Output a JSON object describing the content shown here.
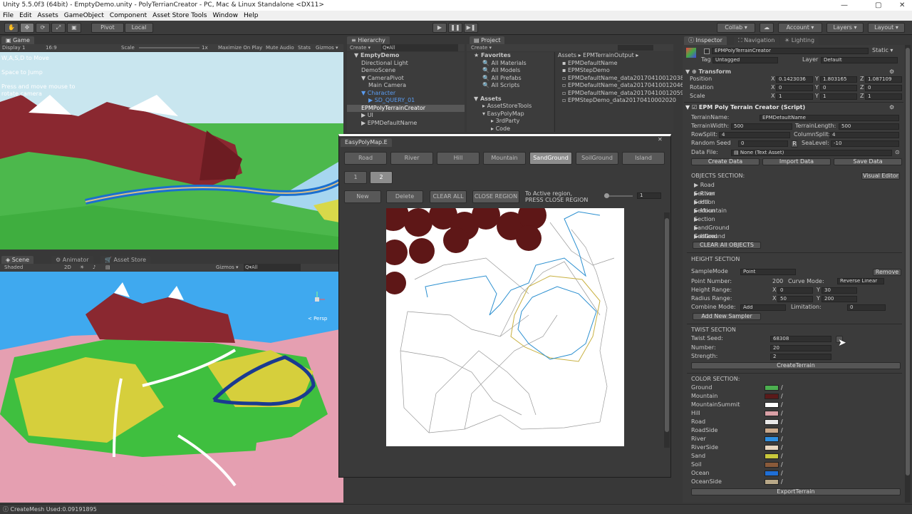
{
  "window": {
    "title": "Unity 5.5.0f3 (64bit) - EmptyDemo.unity - PolyTerrianCreator - PC, Mac & Linux Standalone <DX11>",
    "controls": [
      "—",
      "▢",
      "✕"
    ]
  },
  "menu": [
    "File",
    "Edit",
    "Assets",
    "GameObject",
    "Component",
    "Asset Store Tools",
    "Window",
    "Help"
  ],
  "toolbar": {
    "pivot": "Pivot",
    "local": "Local",
    "collab": "Collab ▾",
    "account": "Account ▾",
    "layers": "Layers ▾",
    "layout": "Layout ▾"
  },
  "game": {
    "tab": "Game",
    "display": "Display 1",
    "aspect": "16:9",
    "scale_label": "Scale",
    "scale_value": "1x",
    "maximize": "Maximize On Play",
    "mute": "Mute Audio",
    "stats": "Stats",
    "gizmos": "Gizmos ▾",
    "overlay": [
      "W,A,S,D to Move",
      "Space to Jump",
      "Press and move mouse to rotate camera"
    ]
  },
  "scene": {
    "tabs": [
      "Scene",
      "Animator",
      "Asset Store"
    ],
    "shaded": "Shaded",
    "mode2d": "2D",
    "gizmos": "Gizmos ▾",
    "search": "Q▾All",
    "persp": "< Persp"
  },
  "hierarchy": {
    "tab": "Hierarchy",
    "create": "Create ▾",
    "search": "Q▾All",
    "items": [
      {
        "label": "▼ EmptyDemo",
        "indent": 0,
        "bold": true
      },
      {
        "label": "Directional Light",
        "indent": 1
      },
      {
        "label": "DemoScene",
        "indent": 1
      },
      {
        "label": "▼ CameraPivot",
        "indent": 1
      },
      {
        "label": "Main Camera",
        "indent": 2
      },
      {
        "label": "▼ Character",
        "indent": 1,
        "blue": true
      },
      {
        "label": "▶ SD_QUERY_01",
        "indent": 2,
        "blue": true
      },
      {
        "label": "EPMPolyTerrainCreator",
        "indent": 1,
        "selected": true
      },
      {
        "label": "▶ UI",
        "indent": 1
      },
      {
        "label": "▶ EPMDefaultName",
        "indent": 1
      }
    ]
  },
  "project": {
    "tab": "Project",
    "create": "Create ▾",
    "favorites_label": "Favorites",
    "favorites": [
      "All Materials",
      "All Models",
      "All Prefabs",
      "All Scripts"
    ],
    "assets_label": "Assets",
    "assets": [
      "AssetStoreTools",
      "EasyPolyMap",
      "3rdParty",
      "Code"
    ],
    "breadcrumb": "Assets ▸ EPMTerrainOutput ▸",
    "files": [
      "EPMDefaultName",
      "EPMStepDemo",
      "EPMDefaultName_data20170410012038",
      "EPMDefaultName_data20170410012046",
      "EPMDefaultName_data20170410012059",
      "EPMStepDemo_data20170410002020"
    ]
  },
  "easypolymap": {
    "tab": "EasyPolyMap.E",
    "types": [
      "Road",
      "River",
      "Hill",
      "Mountain",
      "SandGround",
      "SoilGround",
      "Island"
    ],
    "selected_type": "SandGround",
    "pages": [
      "1",
      "2"
    ],
    "selected_page": "2",
    "actions": {
      "new": "New",
      "delete": "Delete",
      "clear_all": "CLEAR ALL",
      "close_region": "CLOSE REGION"
    },
    "hint_line1": "To Active region,",
    "hint_line2": "PRESS CLOSE REGION",
    "slider_value": "1"
  },
  "inspector": {
    "tabs": [
      "Inspector",
      "Navigation",
      "Lighting"
    ],
    "object_name": "EPMPolyTerrainCreator",
    "static_label": "Static ▾",
    "tag_label": "Tag",
    "tag_value": "Untagged",
    "layer_label": "Layer",
    "layer_value": "Default",
    "transform": {
      "title": "Transform",
      "position_label": "Position",
      "rotation_label": "Rotation",
      "scale_label": "Scale",
      "position": [
        "0.1423036",
        "1.803165",
        "1.087109"
      ],
      "rotation": [
        "0",
        "0",
        "0"
      ],
      "scale": [
        "1",
        "1",
        "1"
      ]
    },
    "script": {
      "title": "EPM Poly Terrain Creator (Script)",
      "terrain_name_label": "TerrainName:",
      "terrain_name": "EPMDefaultName",
      "width_label": "TerrainWidth:",
      "width": "500",
      "length_label": "TerrainLength:",
      "length": "500",
      "rowsplit_label": "RowSplit:",
      "rowsplit": "4",
      "colsplit_label": "ColumnSplit:",
      "colsplit": "4",
      "seed_label": "Random Seed",
      "seed": "0",
      "r_btn": "R",
      "sealevel_label": "SeaLevel:",
      "sealevel": "-10",
      "datafile_label": "Data File:",
      "datafile": "None (Text Asset)",
      "create_data": "Create Data",
      "import_data": "Import Data",
      "save_data": "Save Data"
    },
    "objects": {
      "title": "OBJECTS SECTION:",
      "visual_editor": "Visual Editor",
      "items": [
        "Road Section",
        "River Section",
        "Hill Section",
        "Mountain Section",
        "SandGround Section",
        "SoilGround Section",
        "Island Section"
      ],
      "clear": "CLEAR All OBJECTS"
    },
    "height": {
      "title": "HEIGHT SECTION",
      "samplemode_label": "SampleMode",
      "samplemode": "Point",
      "remove": "Remove",
      "pointnumber_label": "Point Number:",
      "pointnumber": "200",
      "curve_label": "Curve Mode:",
      "curve": "Reverse Linear",
      "heightrange_label": "Height Range:",
      "heightrange_x": "0",
      "heightrange_y": "30",
      "radiusrange_label": "Radius Range:",
      "radiusrange_x": "50",
      "radiusrange_y": "200",
      "combine_label": "Combine Mode:",
      "combine": "Add",
      "limitation_label": "Limitation:",
      "limitation": "0",
      "add_sampler": "Add New Sampler"
    },
    "twist": {
      "title": "TWIST SECTION",
      "seed_label": "Twist Seed:",
      "seed": "68308",
      "number_label": "Number:",
      "number": "20",
      "strength_label": "Strength:",
      "strength": "2",
      "create": "CreateTerrain"
    },
    "color": {
      "title": "COLOR SECTION:",
      "items": [
        {
          "label": "Ground",
          "color": "#4caf50"
        },
        {
          "label": "Mountain",
          "color": "#5a1a1a"
        },
        {
          "label": "MountainSummit",
          "color": "#ffffff"
        },
        {
          "label": "Hill",
          "color": "#d9a0a6"
        },
        {
          "label": "Road",
          "color": "#e8e8e8"
        },
        {
          "label": "RoadSide",
          "color": "#c9a88a"
        },
        {
          "label": "River",
          "color": "#2f8fe0"
        },
        {
          "label": "RiverSide",
          "color": "#e7d6bf"
        },
        {
          "label": "Sand",
          "color": "#c8c83c"
        },
        {
          "label": "Soil",
          "color": "#8a5a3a"
        },
        {
          "label": "Ocean",
          "color": "#1f6fd6"
        },
        {
          "label": "OceanSide",
          "color": "#b8a888"
        }
      ]
    },
    "export": "ExportTerrain"
  },
  "status": "CreateMesh Used:0.09191895"
}
